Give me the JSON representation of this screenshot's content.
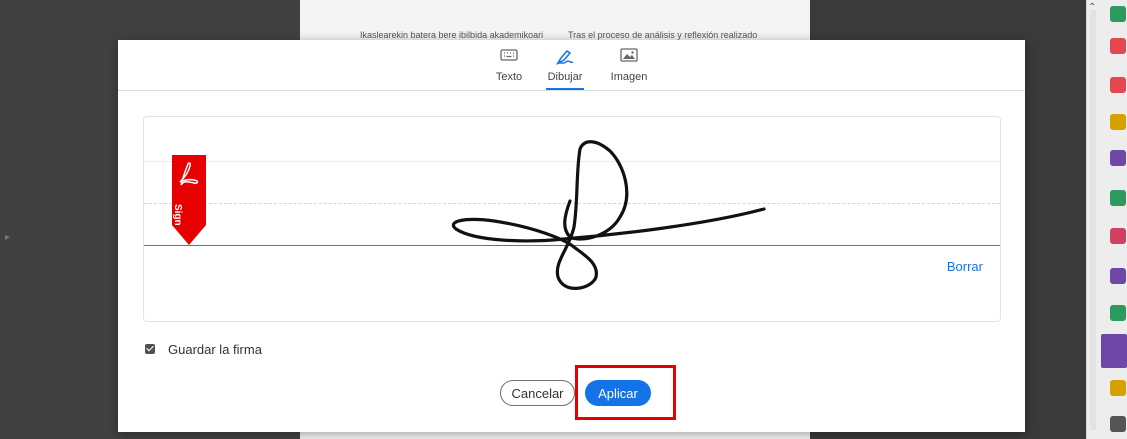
{
  "background_doc": {
    "left_text": "Ikaslearekin batera bere ibilbida akademikoari",
    "right_text": "Tras el proceso de análisis y reflexión realizado"
  },
  "tabs": [
    {
      "label": "Texto",
      "icon": "keyboard-icon",
      "active": false
    },
    {
      "label": "Dibujar",
      "icon": "pen-draw-icon",
      "active": true
    },
    {
      "label": "Imagen",
      "icon": "image-icon",
      "active": false
    }
  ],
  "sign_flag": {
    "label": "Sign",
    "color": "#e60000"
  },
  "clear_label": "Borrar",
  "save_signature": {
    "label": "Guardar la firma",
    "checked": true
  },
  "buttons": {
    "cancel": "Cancelar",
    "apply": "Aplicar"
  },
  "colors": {
    "accent": "#1473e6",
    "highlight": "#e60000",
    "tool_active": "#6e47a8"
  }
}
